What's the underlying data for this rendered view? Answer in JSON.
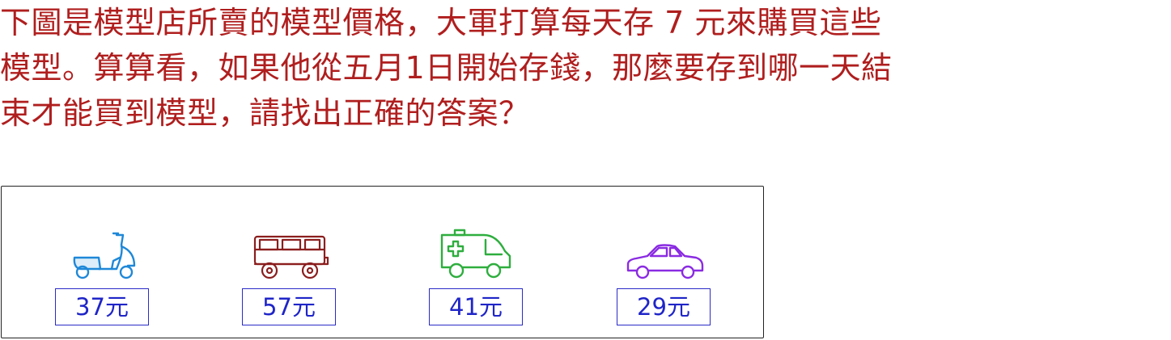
{
  "question": {
    "line1": "下圖是模型店所賣的模型價格，大軍打算每天存 7 元來購買這些",
    "line2": "模型。算算看，如果他從五月1日開始存錢，那麼要存到哪一天結",
    "line3": "束才能買到模型，請找出正確的答案？"
  },
  "models": [
    {
      "icon": "scooter-icon",
      "price": "37元",
      "color": "#1e88d8"
    },
    {
      "icon": "jeep-icon",
      "price": "57元",
      "color": "#8b1e1e"
    },
    {
      "icon": "ambulance-icon",
      "price": "41元",
      "color": "#2eae3e"
    },
    {
      "icon": "car-icon",
      "price": "29元",
      "color": "#8a2be2"
    }
  ],
  "colors": {
    "question_text": "#b01e1e",
    "price_text": "#1f25c8",
    "price_border": "#2b2bc8",
    "panel_border": "#222222"
  }
}
